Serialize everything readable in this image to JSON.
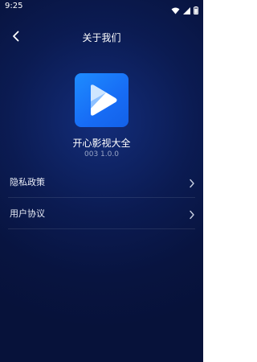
{
  "status": {
    "time": "9:25"
  },
  "header": {
    "title": "关于我们"
  },
  "app": {
    "name": "开心影视大全",
    "version": "003 1.0.0"
  },
  "menu": [
    {
      "label": "隐私政策"
    },
    {
      "label": "用户协议"
    }
  ],
  "icons": {
    "back": "chevron-left-icon",
    "chevron": "chevron-right-icon",
    "wifi": "wifi-icon",
    "signal": "signal-icon",
    "battery": "battery-icon"
  },
  "colors": {
    "background": "#0b1b52",
    "logo": "#1e8cff"
  }
}
